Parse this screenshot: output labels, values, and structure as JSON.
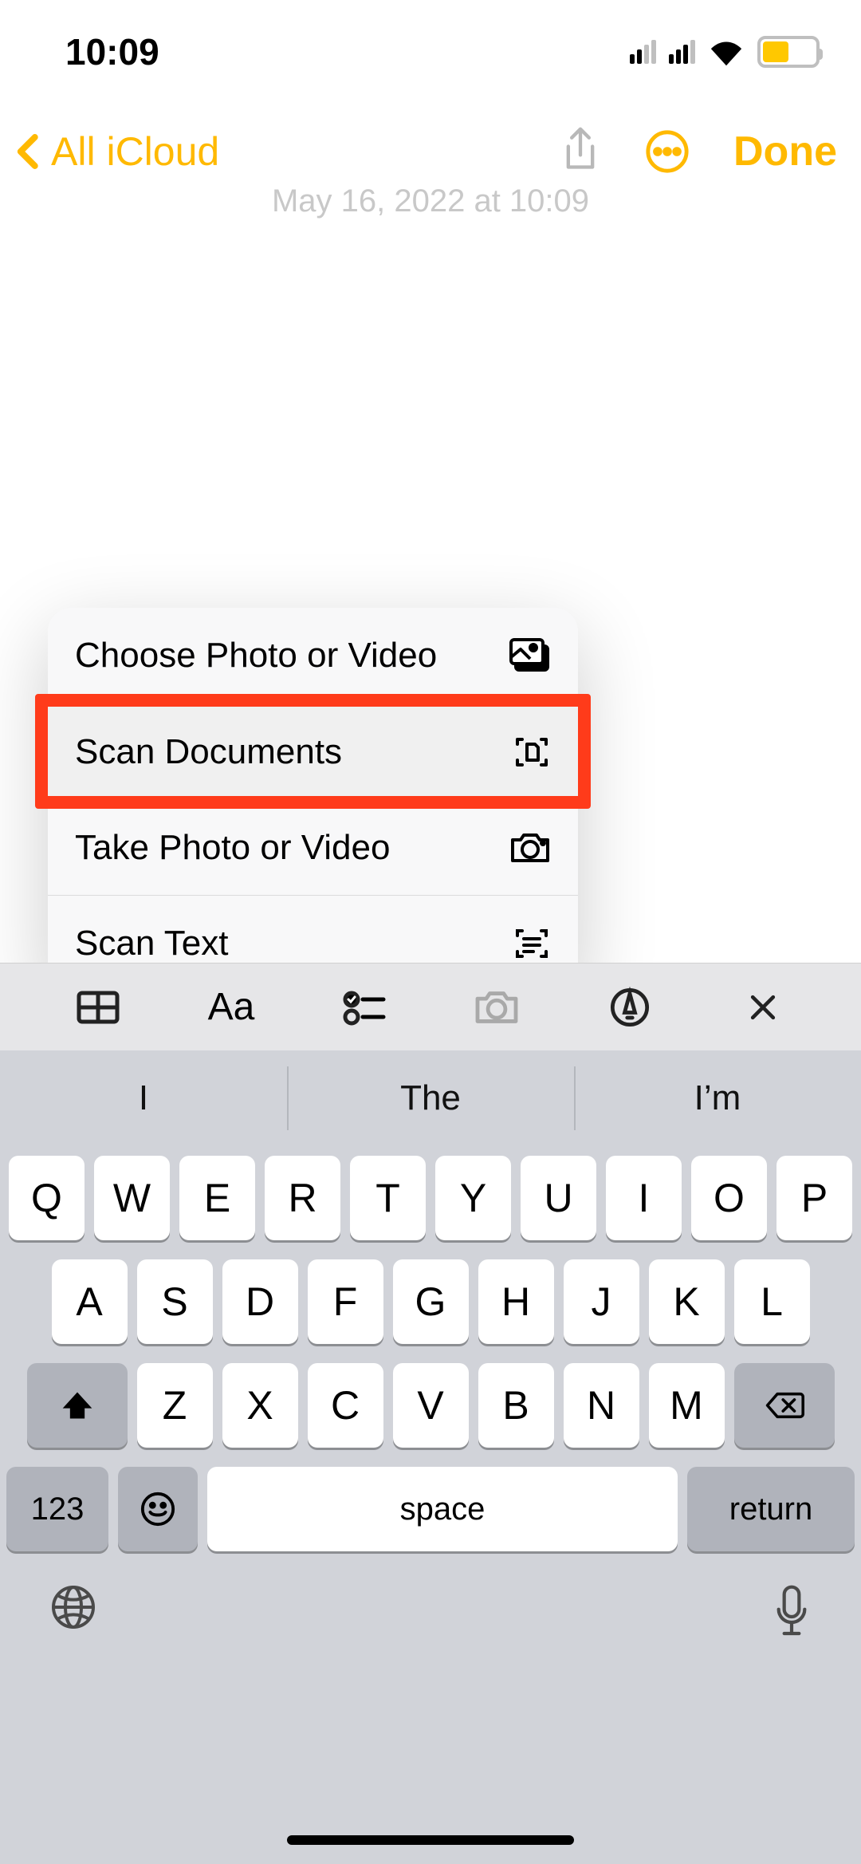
{
  "status": {
    "time": "10:09",
    "battery_color": "#ffc800"
  },
  "nav": {
    "back_label": "All iCloud",
    "done_label": "Done"
  },
  "note": {
    "timestamp": "May 16, 2022 at 10:09"
  },
  "action_sheet": {
    "items": [
      {
        "label": "Choose Photo or Video",
        "icon": "photos-icon"
      },
      {
        "label": "Scan Documents",
        "icon": "document-scan-icon",
        "highlighted": true
      },
      {
        "label": "Take Photo or Video",
        "icon": "camera-icon"
      },
      {
        "label": "Scan Text",
        "icon": "text-scan-icon"
      }
    ]
  },
  "toolbar": {
    "table_icon": "table",
    "format_label": "Aa",
    "checklist_icon": "checklist",
    "camera_icon": "camera",
    "draw_icon": "markup",
    "close_icon": "close"
  },
  "keyboard": {
    "suggestions": [
      "I",
      "The",
      "I’m"
    ],
    "row1": [
      "Q",
      "W",
      "E",
      "R",
      "T",
      "Y",
      "U",
      "I",
      "O",
      "P"
    ],
    "row2": [
      "A",
      "S",
      "D",
      "F",
      "G",
      "H",
      "J",
      "K",
      "L"
    ],
    "row3": [
      "Z",
      "X",
      "C",
      "V",
      "B",
      "N",
      "M"
    ],
    "nums_label": "123",
    "space_label": "space",
    "return_label": "return"
  }
}
